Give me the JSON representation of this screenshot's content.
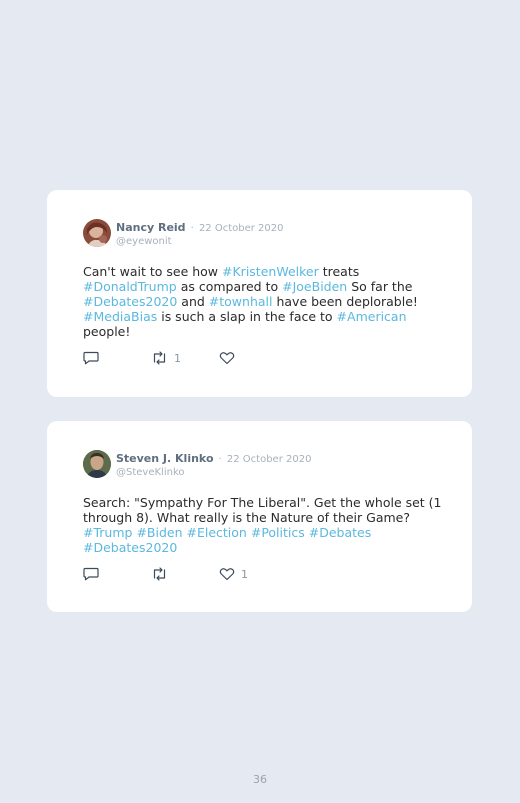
{
  "tweets": [
    {
      "name": "Nancy Reid",
      "separator": "·",
      "date": "22 October 2020",
      "handle": "@eyewonit",
      "body": [
        {
          "t": "Can't wait to see how "
        },
        {
          "t": "#KristenWelker",
          "tag": true
        },
        {
          "t": " treats "
        },
        {
          "t": "#DonaldTrump",
          "tag": true
        },
        {
          "t": " as compared to "
        },
        {
          "t": "#JoeBiden",
          "tag": true
        },
        {
          "t": " So far the "
        },
        {
          "t": "#Debates2020",
          "tag": true
        },
        {
          "t": " and "
        },
        {
          "t": "#townhall",
          "tag": true
        },
        {
          "t": " have been deplorable! "
        },
        {
          "t": "#MediaBias",
          "tag": true
        },
        {
          "t": " is such a slap in the face to "
        },
        {
          "t": "#American",
          "tag": true
        },
        {
          "t": " people!"
        }
      ],
      "reply_count": "",
      "retweet_count": "1",
      "like_count": ""
    },
    {
      "name": "Steven J. Klinko",
      "separator": "·",
      "date": "22 October 2020",
      "handle": "@SteveKlinko",
      "body": [
        {
          "t": "Search: \"Sympathy For The Liberal\". Get the whole set (1 through 8). What really is the Nature of their Game? "
        },
        {
          "t": "#Trump",
          "tag": true
        },
        {
          "t": " "
        },
        {
          "t": "#Biden",
          "tag": true
        },
        {
          "t": " "
        },
        {
          "t": "#Election",
          "tag": true
        },
        {
          "t": " "
        },
        {
          "t": "#Politics",
          "tag": true
        },
        {
          "t": " "
        },
        {
          "t": "#Debates",
          "tag": true
        },
        {
          "t": " "
        },
        {
          "t": "#Debates2020",
          "tag": true
        }
      ],
      "reply_count": "",
      "retweet_count": "",
      "like_count": "1"
    }
  ],
  "icons": {
    "reply": "reply-icon",
    "retweet": "retweet-icon",
    "like": "heart-icon"
  },
  "colors": {
    "background": "#e4e9f2",
    "card": "#ffffff",
    "hashtag": "#5bb8df",
    "name": "#5f6f80",
    "muted": "#a7b1bc"
  },
  "page_number": "36"
}
